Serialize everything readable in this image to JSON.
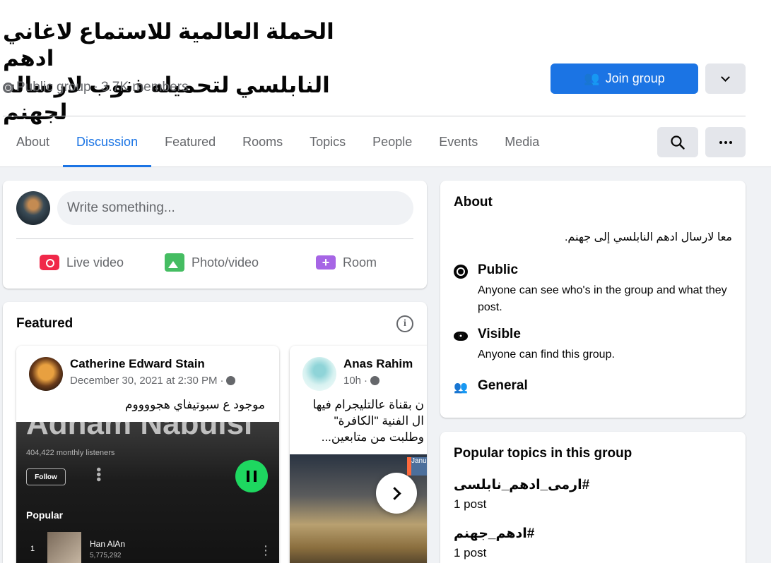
{
  "group": {
    "title_line1": "الحملة العالمية للاستماع لاغاني ادهم",
    "title_line2": "النابلسي لتحميله ذنوب لارساله لجهنم",
    "privacy": "Public group",
    "separator": "·",
    "members": "3.7K members",
    "join_label": "Join group"
  },
  "tabs": [
    "About",
    "Discussion",
    "Featured",
    "Rooms",
    "Topics",
    "People",
    "Events",
    "Media"
  ],
  "active_tab": "Discussion",
  "composer": {
    "placeholder": "Write something...",
    "actions": [
      {
        "label": "Live video",
        "icon": "live-video-icon",
        "color": "#f02849"
      },
      {
        "label": "Photo/video",
        "icon": "photo-video-icon",
        "color": "#45bd62"
      },
      {
        "label": "Room",
        "icon": "room-icon",
        "color": "#a665e5"
      }
    ]
  },
  "featured": {
    "title": "Featured",
    "posts": [
      {
        "author": "Catherine Edward Stain",
        "time": "December 30, 2021 at 2:30 PM",
        "sep": "·",
        "text": "موجود ع سبوتيفاي هجووووم",
        "embed": {
          "artist": "Adham Nabulsi",
          "listeners": "404,422 monthly listeners",
          "follow": "Follow",
          "popular": "Popular",
          "rank": "1",
          "song": "Han AlAn",
          "plays": "5,775,292"
        }
      },
      {
        "author": "Anas Rahim",
        "time": "10h",
        "sep": "·",
        "text_lines": [
          "ن بقناة عالتليجرام فيها",
          "ال الفنية \"الكافرة\"",
          "وطلبت من متابعين..."
        ],
        "embed_tag": "Janu"
      }
    ]
  },
  "about": {
    "title": "About",
    "description": "معا لارسال ادهم النابلسي إلى جهنم.",
    "rows": [
      {
        "icon": "globe-icon",
        "heading": "Public",
        "sub": "Anyone can see who's in the group and what they post."
      },
      {
        "icon": "eye-icon",
        "heading": "Visible",
        "sub": "Anyone can find this group."
      },
      {
        "icon": "group-icon",
        "heading": "General",
        "sub": ""
      }
    ]
  },
  "topics": {
    "title": "Popular topics in this group",
    "items": [
      {
        "name": "#ارمى_ادهم_نابلسى",
        "count": "1 post"
      },
      {
        "name": "#ادهم_جهنم",
        "count": "1 post"
      }
    ]
  },
  "colors": {
    "accent": "#1b74e4",
    "spotify_green": "#1ed760"
  }
}
